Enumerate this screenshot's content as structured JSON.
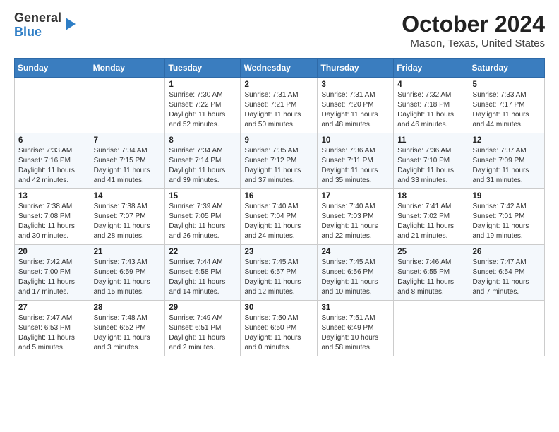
{
  "logo": {
    "line1": "General",
    "line2": "Blue"
  },
  "title": "October 2024",
  "subtitle": "Mason, Texas, United States",
  "days_of_week": [
    "Sunday",
    "Monday",
    "Tuesday",
    "Wednesday",
    "Thursday",
    "Friday",
    "Saturday"
  ],
  "weeks": [
    [
      {
        "day": "",
        "info": ""
      },
      {
        "day": "",
        "info": ""
      },
      {
        "day": "1",
        "info": "Sunrise: 7:30 AM\nSunset: 7:22 PM\nDaylight: 11 hours and 52 minutes."
      },
      {
        "day": "2",
        "info": "Sunrise: 7:31 AM\nSunset: 7:21 PM\nDaylight: 11 hours and 50 minutes."
      },
      {
        "day": "3",
        "info": "Sunrise: 7:31 AM\nSunset: 7:20 PM\nDaylight: 11 hours and 48 minutes."
      },
      {
        "day": "4",
        "info": "Sunrise: 7:32 AM\nSunset: 7:18 PM\nDaylight: 11 hours and 46 minutes."
      },
      {
        "day": "5",
        "info": "Sunrise: 7:33 AM\nSunset: 7:17 PM\nDaylight: 11 hours and 44 minutes."
      }
    ],
    [
      {
        "day": "6",
        "info": "Sunrise: 7:33 AM\nSunset: 7:16 PM\nDaylight: 11 hours and 42 minutes."
      },
      {
        "day": "7",
        "info": "Sunrise: 7:34 AM\nSunset: 7:15 PM\nDaylight: 11 hours and 41 minutes."
      },
      {
        "day": "8",
        "info": "Sunrise: 7:34 AM\nSunset: 7:14 PM\nDaylight: 11 hours and 39 minutes."
      },
      {
        "day": "9",
        "info": "Sunrise: 7:35 AM\nSunset: 7:12 PM\nDaylight: 11 hours and 37 minutes."
      },
      {
        "day": "10",
        "info": "Sunrise: 7:36 AM\nSunset: 7:11 PM\nDaylight: 11 hours and 35 minutes."
      },
      {
        "day": "11",
        "info": "Sunrise: 7:36 AM\nSunset: 7:10 PM\nDaylight: 11 hours and 33 minutes."
      },
      {
        "day": "12",
        "info": "Sunrise: 7:37 AM\nSunset: 7:09 PM\nDaylight: 11 hours and 31 minutes."
      }
    ],
    [
      {
        "day": "13",
        "info": "Sunrise: 7:38 AM\nSunset: 7:08 PM\nDaylight: 11 hours and 30 minutes."
      },
      {
        "day": "14",
        "info": "Sunrise: 7:38 AM\nSunset: 7:07 PM\nDaylight: 11 hours and 28 minutes."
      },
      {
        "day": "15",
        "info": "Sunrise: 7:39 AM\nSunset: 7:05 PM\nDaylight: 11 hours and 26 minutes."
      },
      {
        "day": "16",
        "info": "Sunrise: 7:40 AM\nSunset: 7:04 PM\nDaylight: 11 hours and 24 minutes."
      },
      {
        "day": "17",
        "info": "Sunrise: 7:40 AM\nSunset: 7:03 PM\nDaylight: 11 hours and 22 minutes."
      },
      {
        "day": "18",
        "info": "Sunrise: 7:41 AM\nSunset: 7:02 PM\nDaylight: 11 hours and 21 minutes."
      },
      {
        "day": "19",
        "info": "Sunrise: 7:42 AM\nSunset: 7:01 PM\nDaylight: 11 hours and 19 minutes."
      }
    ],
    [
      {
        "day": "20",
        "info": "Sunrise: 7:42 AM\nSunset: 7:00 PM\nDaylight: 11 hours and 17 minutes."
      },
      {
        "day": "21",
        "info": "Sunrise: 7:43 AM\nSunset: 6:59 PM\nDaylight: 11 hours and 15 minutes."
      },
      {
        "day": "22",
        "info": "Sunrise: 7:44 AM\nSunset: 6:58 PM\nDaylight: 11 hours and 14 minutes."
      },
      {
        "day": "23",
        "info": "Sunrise: 7:45 AM\nSunset: 6:57 PM\nDaylight: 11 hours and 12 minutes."
      },
      {
        "day": "24",
        "info": "Sunrise: 7:45 AM\nSunset: 6:56 PM\nDaylight: 11 hours and 10 minutes."
      },
      {
        "day": "25",
        "info": "Sunrise: 7:46 AM\nSunset: 6:55 PM\nDaylight: 11 hours and 8 minutes."
      },
      {
        "day": "26",
        "info": "Sunrise: 7:47 AM\nSunset: 6:54 PM\nDaylight: 11 hours and 7 minutes."
      }
    ],
    [
      {
        "day": "27",
        "info": "Sunrise: 7:47 AM\nSunset: 6:53 PM\nDaylight: 11 hours and 5 minutes."
      },
      {
        "day": "28",
        "info": "Sunrise: 7:48 AM\nSunset: 6:52 PM\nDaylight: 11 hours and 3 minutes."
      },
      {
        "day": "29",
        "info": "Sunrise: 7:49 AM\nSunset: 6:51 PM\nDaylight: 11 hours and 2 minutes."
      },
      {
        "day": "30",
        "info": "Sunrise: 7:50 AM\nSunset: 6:50 PM\nDaylight: 11 hours and 0 minutes."
      },
      {
        "day": "31",
        "info": "Sunrise: 7:51 AM\nSunset: 6:49 PM\nDaylight: 10 hours and 58 minutes."
      },
      {
        "day": "",
        "info": ""
      },
      {
        "day": "",
        "info": ""
      }
    ]
  ]
}
